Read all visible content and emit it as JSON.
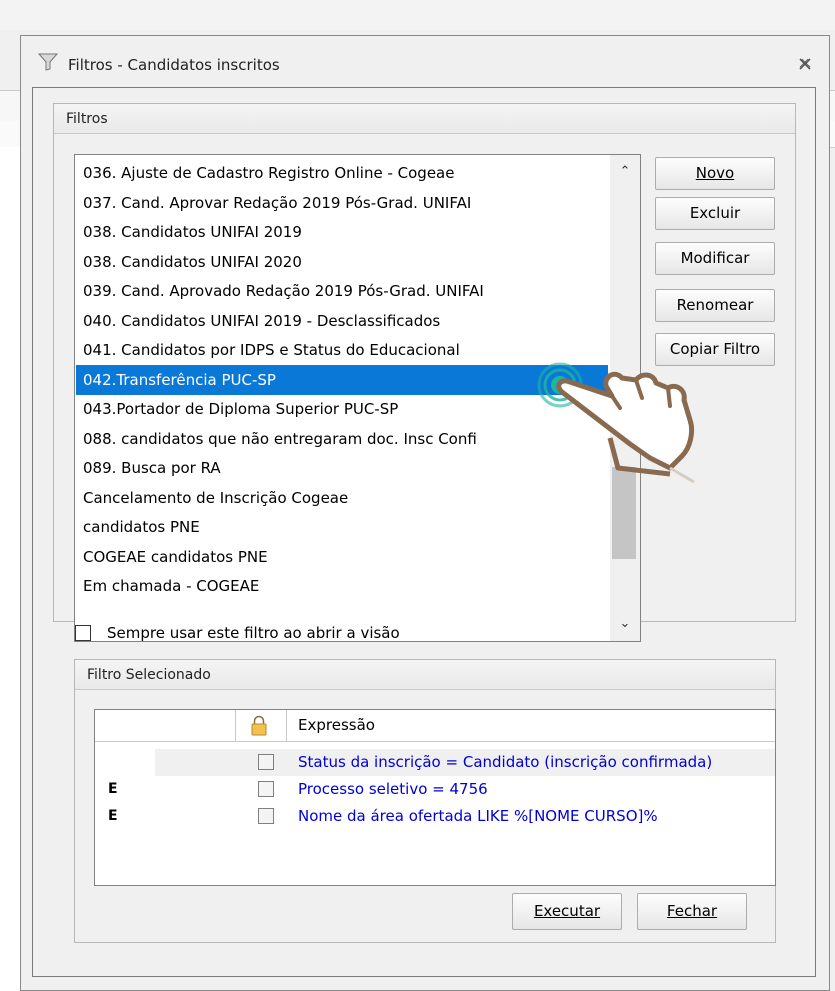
{
  "window": {
    "title": "Filtros - Candidatos inscritos"
  },
  "filters_group": {
    "header": "Filtros",
    "items": [
      "036. Ajuste de Cadastro Registro Online - Cogeae",
      "037. Cand. Aprovar Redação 2019 Pós-Grad. UNIFAI",
      "038. Candidatos UNIFAI 2019",
      "038. Candidatos UNIFAI 2020",
      "039. Cand. Aprovado Redação 2019 Pós-Grad. UNIFAI",
      "040. Candidatos UNIFAI 2019 - Desclassificados",
      "041. Candidatos por IDPS e Status do Educacional",
      "042.Transferência PUC-SP",
      "043.Portador de Diploma Superior PUC-SP",
      "088. candidatos que não entregaram doc. Insc Confi",
      "089. Busca por RA",
      "Cancelamento de Inscrição Cogeae",
      "candidatos PNE",
      "COGEAE candidatos PNE",
      "Em chamada - COGEAE"
    ],
    "selected_item": "042.Transferência PUC-SP",
    "buttons": {
      "novo": "Novo",
      "excluir": "Excluir",
      "modificar": "Modificar",
      "renomear": "Renomear",
      "copiar": "Copiar Filtro"
    },
    "always_use_label": "Sempre usar este filtro ao abrir a visão",
    "always_use_checked": false
  },
  "selected_filter_group": {
    "header": "Filtro Selecionado",
    "column_expression": "Expressão",
    "rows": [
      {
        "logic": "",
        "expression": "Status da inscrição = Candidato (inscrição confirmada)",
        "checked": false
      },
      {
        "logic": "E",
        "expression": "Processo seletivo = 4756",
        "checked": false
      },
      {
        "logic": "E",
        "expression": "Nome da área ofertada LIKE %[NOME CURSO]%",
        "checked": false
      }
    ]
  },
  "footer": {
    "executar": "Executar",
    "fechar": "Fechar"
  },
  "colors": {
    "selection": "#0a78d7",
    "expression_text": "#0000d8",
    "hand_outline": "#8a6a4e",
    "tap_ring": "#20b3a0"
  }
}
